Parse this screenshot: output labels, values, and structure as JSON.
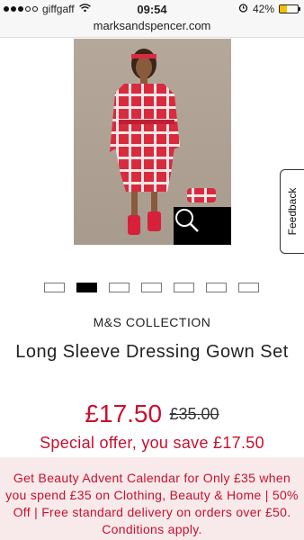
{
  "status_bar": {
    "carrier": "giffgaff",
    "signal_bars_filled": 3,
    "signal_bars_total": 5,
    "time": "09:54",
    "battery_text": "42%",
    "battery_level": 0.42
  },
  "browser": {
    "url": "marksandspencer.com"
  },
  "feedback": {
    "label": "Feedback"
  },
  "carousel": {
    "count": 7,
    "active_index": 1
  },
  "product": {
    "brand": "M&S COLLECTION",
    "title": "Long Sleeve Dressing Gown Set",
    "price": "£17.50",
    "was_price": "£35.00",
    "offer": "Special offer, you save £17.50"
  },
  "promo": {
    "text": "Get Beauty Advent Calendar for Only £35 when you spend £35 on Clothing, Beauty & Home | 50% Off | Free standard delivery on orders over £50. Conditions apply."
  },
  "colors": {
    "accent_red": "#c8102e",
    "promo_bg": "#f8eaea"
  }
}
